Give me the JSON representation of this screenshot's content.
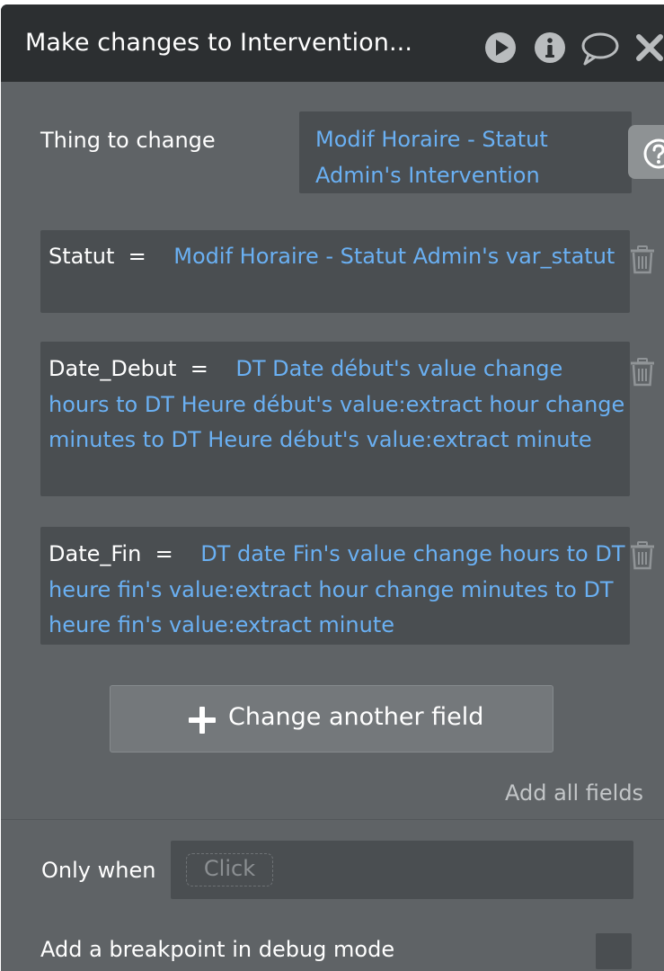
{
  "header": {
    "title": "Make changes to Intervention...",
    "icons": [
      "play-icon",
      "info-icon",
      "comment-icon",
      "close-icon"
    ]
  },
  "thing_to_change": {
    "label": "Thing to change",
    "value": "Modif Horaire - Statut Admin's Intervention"
  },
  "fields": [
    {
      "name": "Statut",
      "operator": "=",
      "expression": "Modif Horaire - Statut Admin's var_statut"
    },
    {
      "name": "Date_Debut",
      "operator": "=",
      "expression": "DT Date début's value change hours to DT Heure début's value:extract hour change minutes to DT Heure début's value:extract minute"
    },
    {
      "name": "Date_Fin",
      "operator": "=",
      "expression": "DT date Fin's value change hours to DT heure fin's value:extract hour change minutes to DT heure fin's value:extract minute"
    }
  ],
  "change_another_field_label": "Change another field",
  "add_all_fields_label": "Add all fields",
  "only_when": {
    "label": "Only when",
    "placeholder": "Click"
  },
  "breakpoint": {
    "label": "Add a breakpoint in debug mode",
    "checked": false
  },
  "colors": {
    "panel_bg": "#5f6366",
    "header_bg": "#2c2f31",
    "field_bg": "#4a4e51",
    "expression_text": "#6ab0f3",
    "button_bg": "#74787b"
  }
}
